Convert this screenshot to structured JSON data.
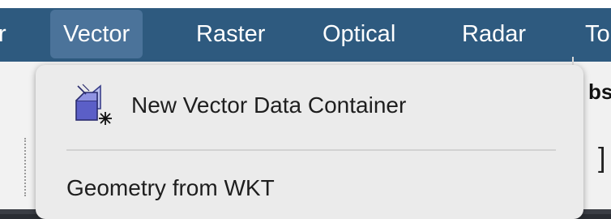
{
  "menubar": {
    "items": [
      {
        "label": "r"
      },
      {
        "label": "Vector"
      },
      {
        "label": "Raster"
      },
      {
        "label": "Optical"
      },
      {
        "label": "Radar"
      },
      {
        "label": "To"
      }
    ]
  },
  "dropdown": {
    "new_container": {
      "label": "New Vector Data Container",
      "icon": "new-vector-container-icon"
    },
    "geometry_wkt": {
      "label": "Geometry from WKT"
    }
  },
  "background": {
    "partial_text": "bs",
    "bracket": "]"
  },
  "colors": {
    "menubar_bg": "#2e5a7f",
    "menubar_active": "#4b739a",
    "dropdown_bg": "#ebebeb"
  }
}
